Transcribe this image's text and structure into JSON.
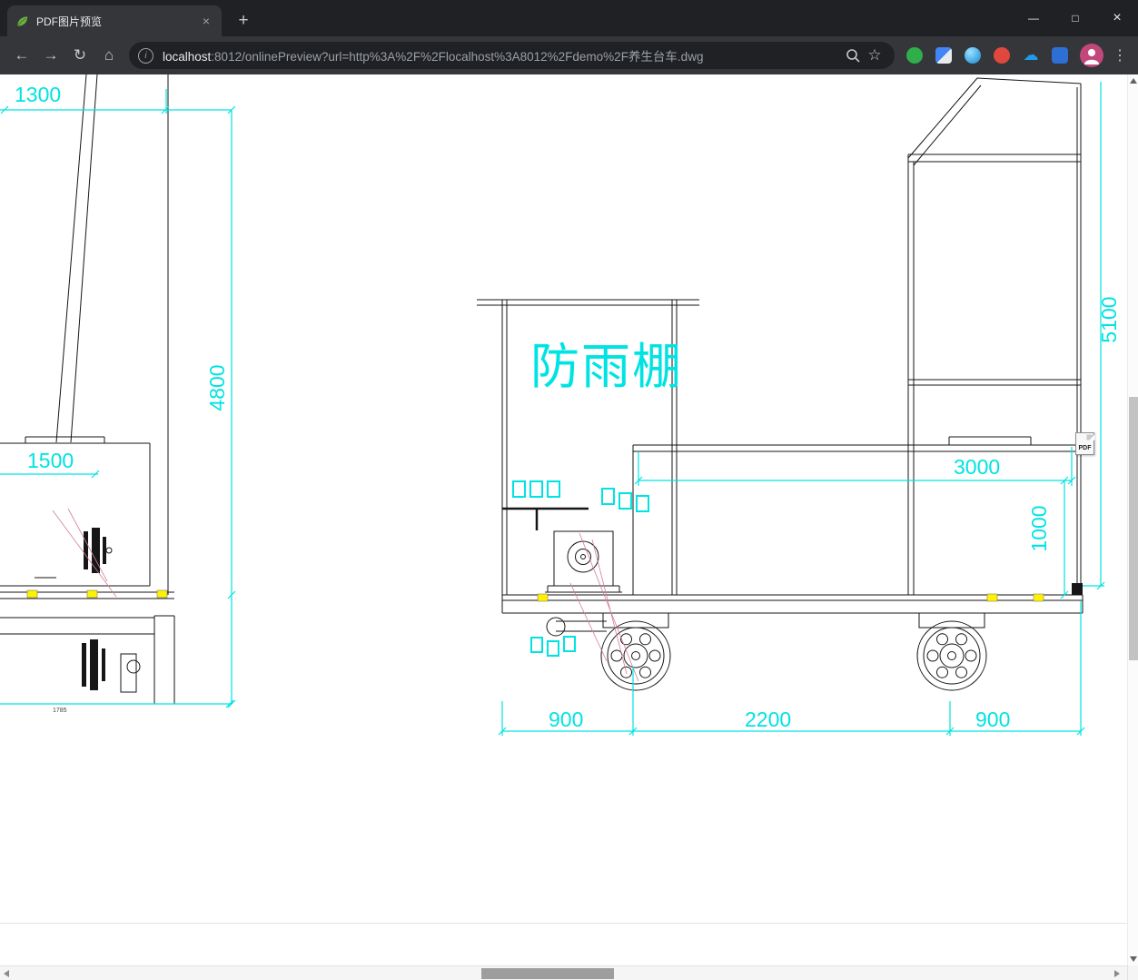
{
  "browser": {
    "window_controls": {
      "minimize": "—",
      "maximize": "□",
      "close": "×"
    },
    "tab": {
      "title": "PDF图片预览",
      "close_glyph": "×"
    },
    "new_tab_glyph": "+",
    "nav": {
      "back": "←",
      "forward": "→",
      "reload": "↻",
      "home": "⌂"
    },
    "omnibox": {
      "info_glyph": "i",
      "url_host": "localhost",
      "url_rest": ":8012/onlinePreview?url=http%3A%2F%2Flocalhost%3A8012%2Fdemo%2F养生台车.dwg",
      "star_glyph": "☆"
    },
    "cloud_glyph": "☁",
    "menu_glyph": "⋮"
  },
  "content": {
    "pdf_badge": "PDF",
    "drawing": {
      "shelter_label": "防雨棚",
      "dims": {
        "d1300": "1300",
        "d4800": "4800",
        "d1500": "1500",
        "d1785": "1785",
        "d5100": "5100",
        "d3000": "3000",
        "d1000": "1000",
        "d900_left": "900",
        "d2200": "2200",
        "d900_right": "900"
      },
      "colors": {
        "dimension": "#00e3e3",
        "line": "#161616",
        "highlight": "#fff200",
        "construction": "#d27f93"
      }
    }
  }
}
